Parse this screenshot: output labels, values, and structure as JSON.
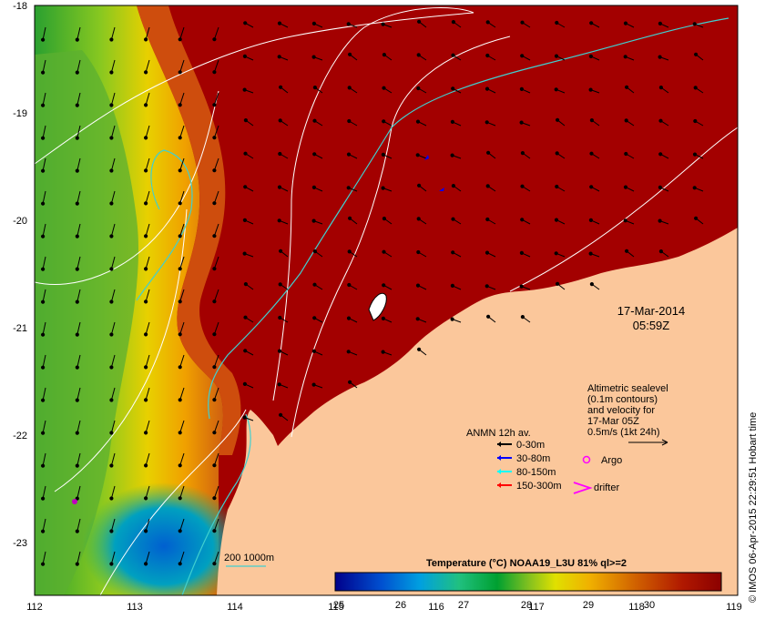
{
  "map": {
    "lon_range": [
      112,
      119
    ],
    "lat_range": [
      -23.5,
      -18
    ],
    "x_ticks": [
      "112",
      "113",
      "114",
      "115",
      "116",
      "117",
      "118",
      "119"
    ],
    "y_ticks": [
      "-18",
      "-19",
      "-20",
      "-21",
      "-22",
      "-23"
    ],
    "land_color": "#fbc79b",
    "sea_warm_color": "#a30000"
  },
  "date_label": {
    "line1": "17-Mar-2014",
    "line2": "05:59Z"
  },
  "altimetry_note": {
    "line1": "Altimetric sealevel",
    "line2": "(0.1m contours)",
    "line3": "and velocity for",
    "line4": "17-Mar 05Z",
    "line5": "0.5m/s (1kt 24h)"
  },
  "anmn_legend": {
    "title": "ANMN 12h av.",
    "items": [
      {
        "label": "0-30m",
        "color": "#000000"
      },
      {
        "label": "30-80m",
        "color": "#0000ff"
      },
      {
        "label": "80-150m",
        "color": "#00ffff"
      },
      {
        "label": "150-300m",
        "color": "#ff0000"
      }
    ]
  },
  "markers": {
    "argo_label": "Argo",
    "drifter_label": "drifter",
    "marker_color": "#ff00ff"
  },
  "isobath_label": "200  1000m",
  "colorbar": {
    "title": "Temperature (°C) NOAA19_L3U 81% ql>=2",
    "ticks": [
      "25",
      "26",
      "27",
      "28",
      "29",
      "30"
    ],
    "range": [
      25,
      30.7
    ]
  },
  "credit": "© IMOS 06-Apr-2015 22:29:51 Hobart time"
}
